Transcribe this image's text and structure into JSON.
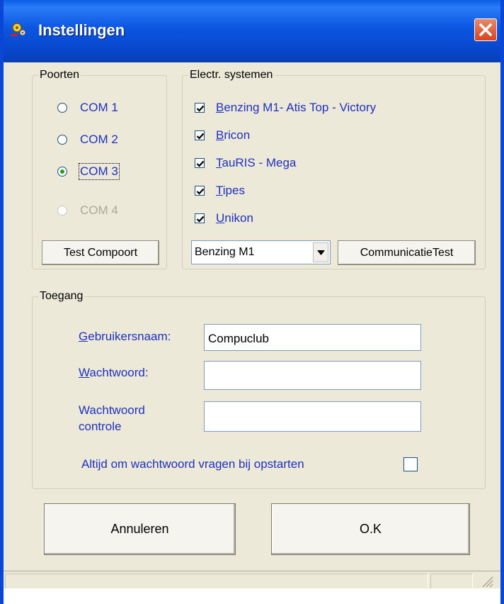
{
  "window": {
    "title": "Instellingen",
    "icon": "gears-icon",
    "close_icon": "close-icon",
    "accent": "#0a5fe6",
    "close_color": "#d8431d"
  },
  "poorten": {
    "legend": "Poorten",
    "options": [
      {
        "label": "COM 1",
        "selected": false,
        "enabled": true
      },
      {
        "label": "COM 2",
        "selected": false,
        "enabled": true
      },
      {
        "label": "COM 3",
        "selected": true,
        "enabled": true
      },
      {
        "label": "COM 4",
        "selected": false,
        "enabled": false
      }
    ],
    "test_button": "Test Compoort"
  },
  "systemen": {
    "legend": "Electr. systemen",
    "items": [
      {
        "accel": "B",
        "rest": "enzing M1- Atis Top - Victory",
        "checked": true
      },
      {
        "accel": "B",
        "rest": "ricon",
        "checked": true
      },
      {
        "accel": "T",
        "rest": "auRIS - Mega",
        "checked": true
      },
      {
        "accel": "T",
        "rest": "ipes",
        "checked": true
      },
      {
        "accel": "U",
        "rest": "nikon",
        "checked": true
      }
    ],
    "select_value": "Benzing M1",
    "test_button": "CommunicatieTest"
  },
  "toegang": {
    "legend": "Toegang",
    "username_label_accel": "G",
    "username_label_rest": "ebruikersnaam:",
    "username_value": "Compuclub",
    "password_label_accel": "W",
    "password_label_rest": "achtwoord:",
    "password_value": "",
    "confirm_label_line1": "Wachtwoord",
    "confirm_label_line2": "controle",
    "confirm_value": "",
    "ask_label": "Altijd om wachtwoord vragen bij opstarten",
    "ask_checked": false
  },
  "buttons": {
    "cancel": "Annuleren",
    "ok": "O.K"
  }
}
